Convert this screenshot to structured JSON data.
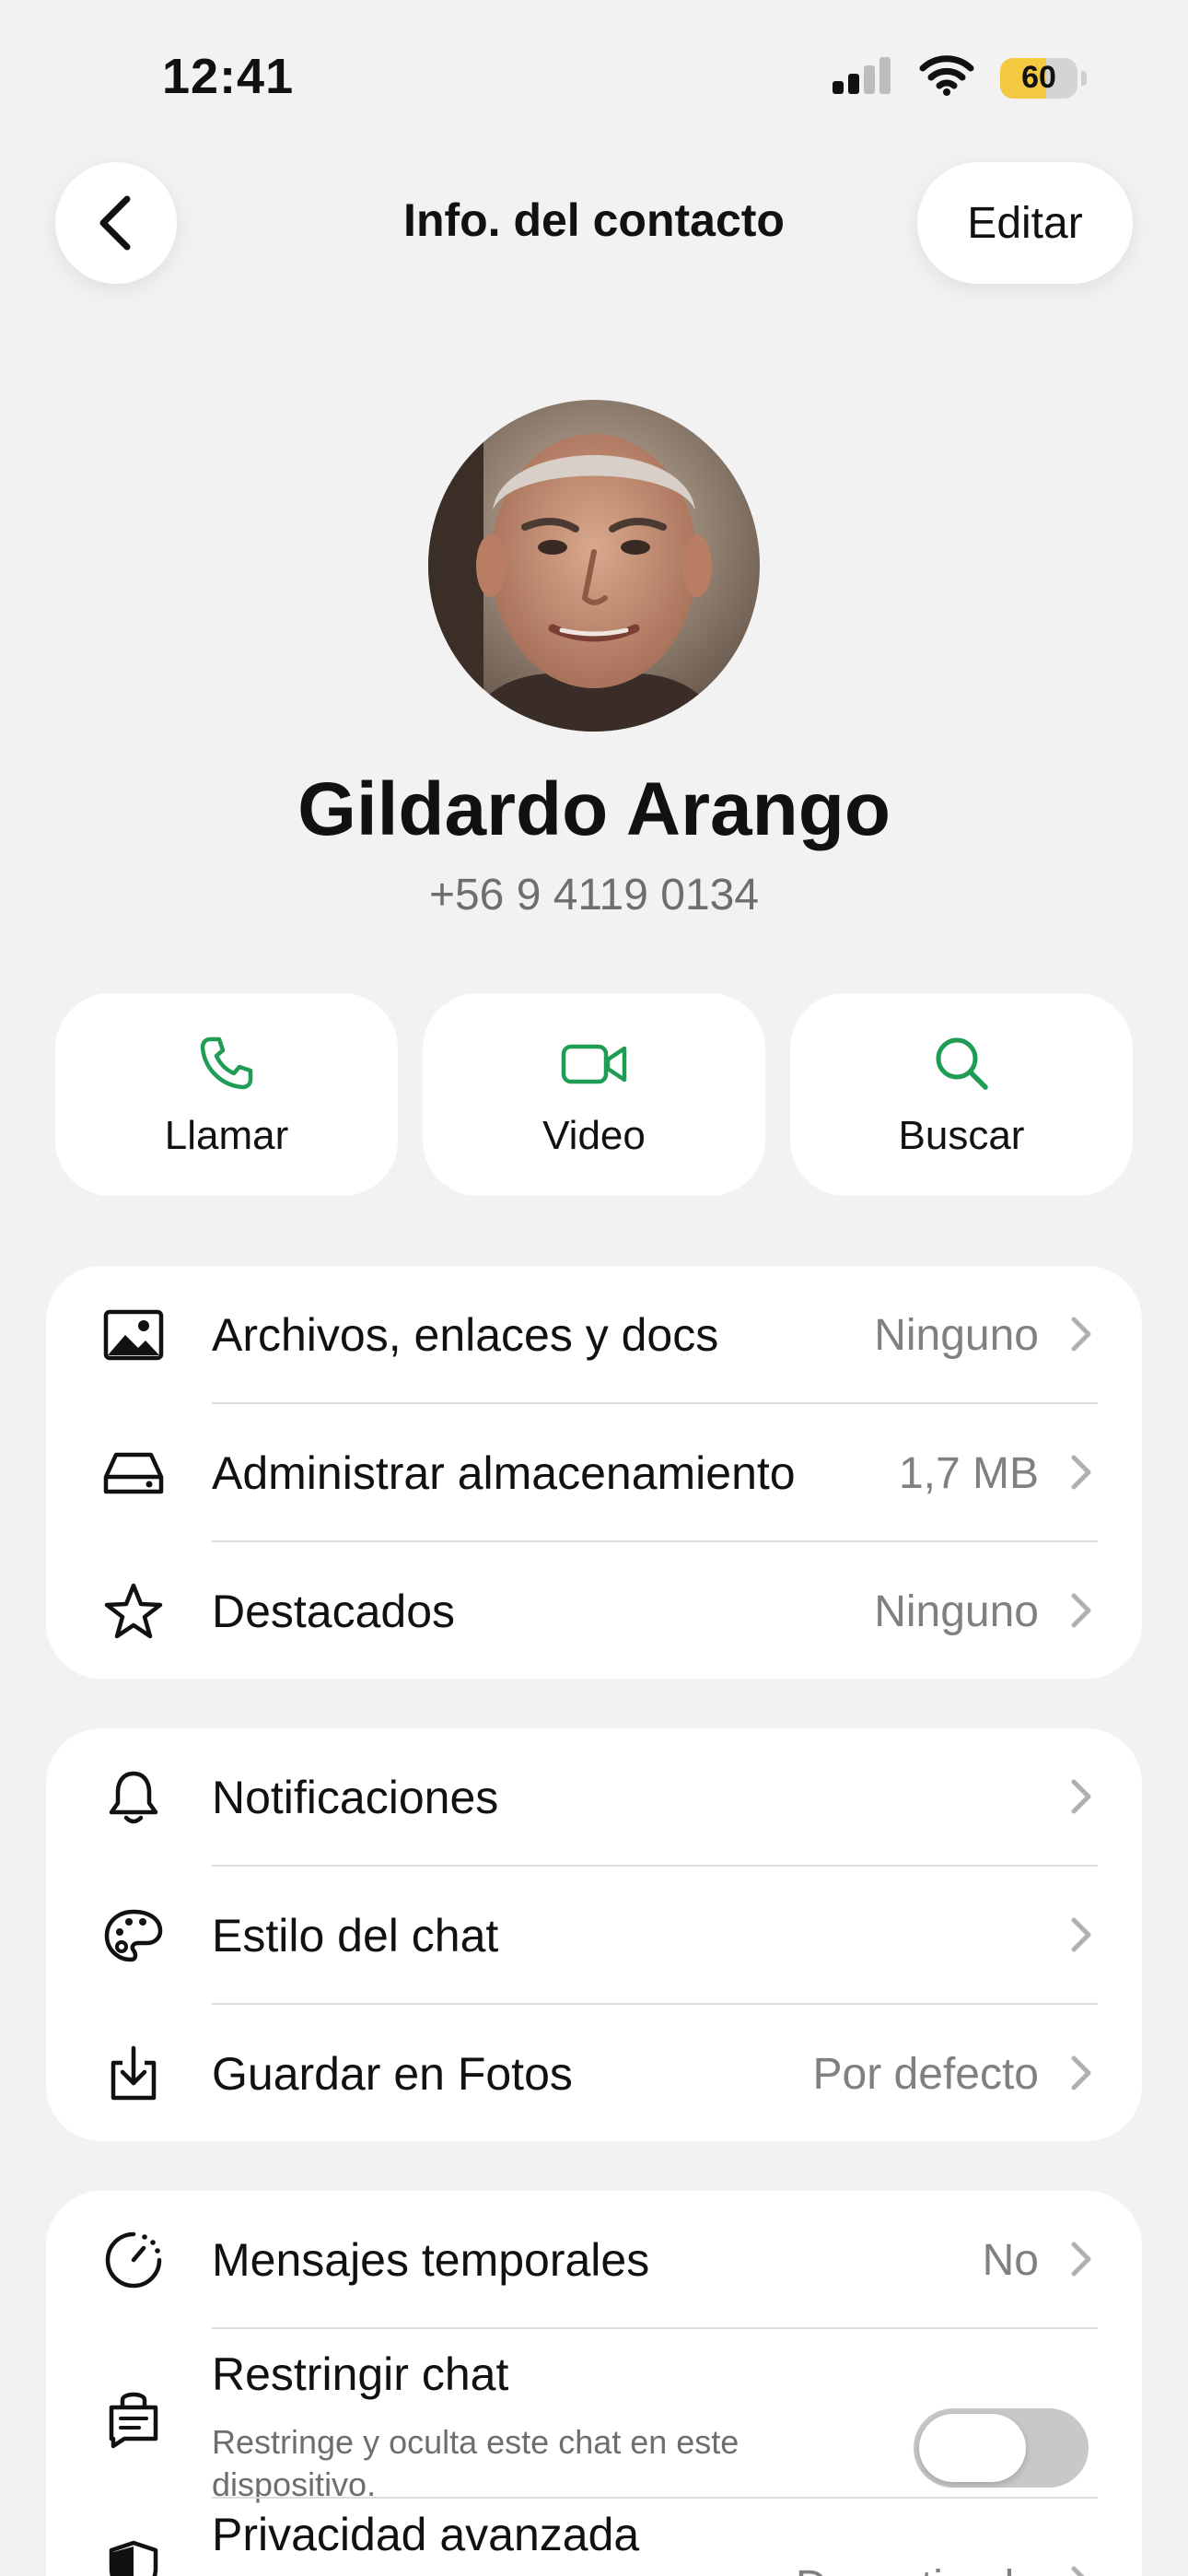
{
  "status_bar": {
    "time": "12:41",
    "battery_level": "60",
    "battery_fraction": 0.6,
    "signal_icon": "cellular-signal-icon",
    "wifi_icon": "wifi-icon"
  },
  "nav": {
    "back_icon": "chevron-left-icon",
    "title": "Info. del contacto",
    "edit_label": "Editar"
  },
  "profile": {
    "name": "Gildardo Arango",
    "phone": "+56 9 4119 0134"
  },
  "actions": [
    {
      "label": "Llamar",
      "icon": "phone-icon"
    },
    {
      "label": "Video",
      "icon": "video-camera-icon"
    },
    {
      "label": "Buscar",
      "icon": "search-icon"
    }
  ],
  "media_section": {
    "items": [
      {
        "label": "Archivos, enlaces y docs",
        "value": "Ninguno",
        "icon": "image-icon"
      },
      {
        "label": "Administrar almacenamiento",
        "value": "1,7 MB",
        "icon": "storage-icon"
      },
      {
        "label": "Destacados",
        "value": "Ninguno",
        "icon": "star-icon"
      }
    ]
  },
  "settings_section": {
    "items": [
      {
        "label": "Notificaciones",
        "value": "",
        "icon": "bell-icon"
      },
      {
        "label": "Estilo del chat",
        "value": "",
        "icon": "palette-icon"
      },
      {
        "label": "Guardar en Fotos",
        "value": "Por defecto",
        "icon": "download-icon"
      }
    ]
  },
  "privacy_section": {
    "items": [
      {
        "label": "Mensajes temporales",
        "value": "No",
        "icon": "timer-icon"
      },
      {
        "label": "Restringir chat",
        "subtitle": "Restringe y oculta este chat en este dispositivo.",
        "toggle_on": false,
        "icon": "lock-chat-icon"
      },
      {
        "label": "Privacidad avanzada",
        "value": "Desactivada",
        "icon": "shield-icon"
      }
    ]
  },
  "colors": {
    "accent_green": "#1f9d55",
    "background": "#f2f2f2",
    "card": "#ffffff",
    "secondary_text": "#808080",
    "battery_yellow": "#f5c842"
  }
}
